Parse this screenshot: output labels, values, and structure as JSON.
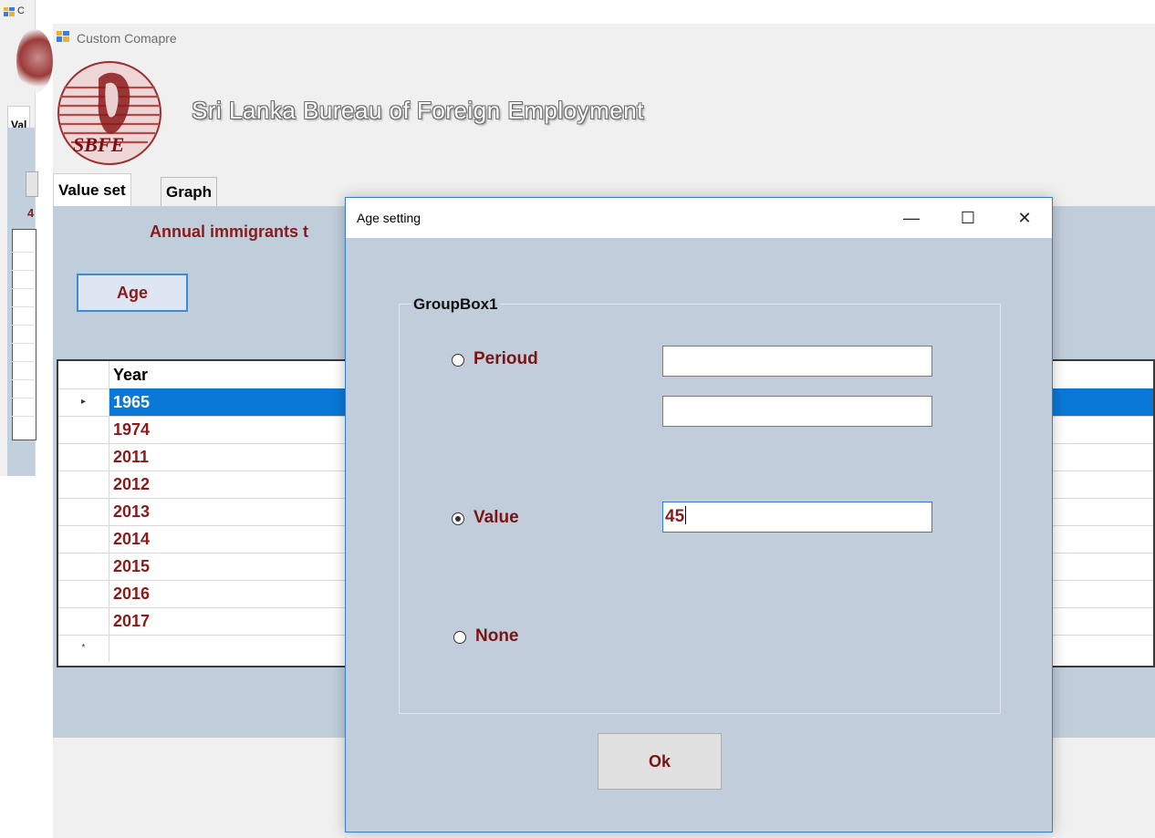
{
  "background_window": {
    "title": "C",
    "tab_label": "Val",
    "value_fragment": "4"
  },
  "main_window": {
    "title": "Custom Comapre",
    "header": {
      "organization": "Sri Lanka Bureau of Foreign Employment",
      "logo_text": "SBFE"
    },
    "tabs": [
      {
        "label": "Value set",
        "active": true
      },
      {
        "label": "Graph",
        "active": false
      }
    ],
    "panel": {
      "heading": "Annual immigrants t",
      "age_button": "Age",
      "grid": {
        "column_header": "Year",
        "rows": [
          "1965",
          "1974",
          "2011",
          "2012",
          "2013",
          "2014",
          "2015",
          "2016",
          "2017"
        ],
        "selected_row_index": 0,
        "new_row_marker": "*",
        "current_row_marker": "▸"
      }
    }
  },
  "dialog": {
    "title": "Age setting",
    "controls": {
      "minimize": "—",
      "maximize": "☐",
      "close": "✕"
    },
    "groupbox_title": "GroupBox1",
    "options": [
      {
        "label": "Perioud",
        "checked": false
      },
      {
        "label": "Value",
        "checked": true
      },
      {
        "label": "None",
        "checked": false
      }
    ],
    "period_from": "",
    "period_to": "",
    "value_input": "45",
    "ok_button": "Ok"
  },
  "colors": {
    "accent": "#0a78d7",
    "text_maroon": "#8b1a1a",
    "panel_blue": "#c0cddb"
  }
}
